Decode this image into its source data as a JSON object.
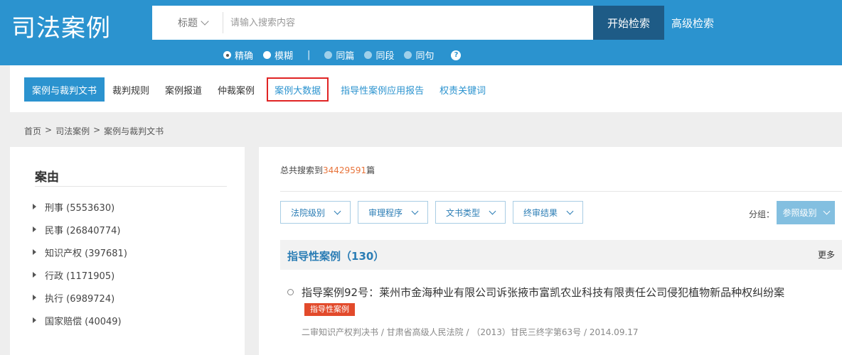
{
  "header": {
    "logo": "司法案例",
    "search": {
      "field_label": "标题",
      "placeholder": "请输入搜索内容",
      "search_button": "开始检索",
      "advanced_link": "高级检索"
    },
    "options": [
      {
        "label": "精确",
        "checked": true
      },
      {
        "label": "模糊",
        "checked": false
      },
      {
        "label": "同篇",
        "checked": false
      },
      {
        "label": "同段",
        "checked": false
      },
      {
        "label": "同句",
        "checked": false
      }
    ],
    "help_symbol": "?"
  },
  "nav": {
    "items": [
      {
        "label": "案例与裁判文书"
      },
      {
        "label": "裁判规则"
      },
      {
        "label": "案例报道"
      },
      {
        "label": "仲裁案例"
      },
      {
        "label": "案例大数据"
      },
      {
        "label": "指导性案例应用报告"
      },
      {
        "label": "权责关键词"
      }
    ]
  },
  "breadcrumb": [
    "首页",
    ">",
    "司法案例",
    ">",
    "案例与裁判文书"
  ],
  "sidebar": {
    "title": "案由",
    "items": [
      {
        "label": "刑事 (5553630)"
      },
      {
        "label": "民事 (26840774)"
      },
      {
        "label": "知识产权 (397681)"
      },
      {
        "label": "行政 (1171905)"
      },
      {
        "label": "执行 (6989724)"
      },
      {
        "label": "国家赔偿 (40049)"
      }
    ]
  },
  "main": {
    "total_prefix": "总共搜索到",
    "total_count": "34429591",
    "total_suffix": "篇",
    "filters": [
      "法院级别",
      "审理程序",
      "文书类型",
      "终审结果"
    ],
    "group_label": "分组：",
    "group_value": "参照级别",
    "section_title": "指导性案例（130）",
    "more": "更多",
    "case": {
      "title": "指导案例92号：莱州市金海种业有限公司诉张掖市富凯农业科技有限责任公司侵犯植物新品种权纠纷案",
      "tag": "指导性案例",
      "meta": "二审知识产权判决书 / 甘肃省高级人民法院 / （2013）甘民三终字第63号 / 2014.09.17"
    }
  }
}
